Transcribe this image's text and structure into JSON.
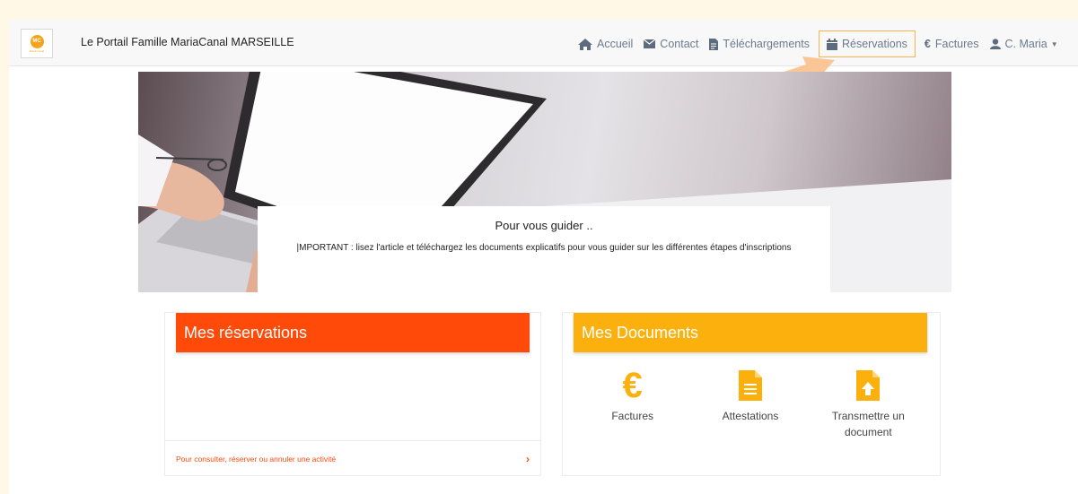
{
  "navbar": {
    "brand": "Le Portail Famille MariaCanal MARSEILLE",
    "logo_text": "MC",
    "items": [
      {
        "label": "Accueil",
        "icon": "home-icon"
      },
      {
        "label": "Contact",
        "icon": "envelope-icon"
      },
      {
        "label": "Téléchargements",
        "icon": "file-icon"
      },
      {
        "label": "Réservations",
        "icon": "calendar-icon",
        "active": true
      },
      {
        "label": "Factures",
        "icon": "euro-icon"
      },
      {
        "label": "C. Maria",
        "icon": "user-icon"
      }
    ]
  },
  "hero": {
    "title": "Pour vous guider ..",
    "text": "|MPORTANT : lisez l'article et téléchargez les documents explicatifs pour vous guider sur les différentes étapes d'inscriptions"
  },
  "reservations": {
    "title": "Mes réservations",
    "link": "Pour consulter, réserver ou annuler une activité"
  },
  "documents": {
    "title": "Mes Documents",
    "items": [
      {
        "label": "Factures",
        "icon": "euro-icon"
      },
      {
        "label": "Attestations",
        "icon": "file-text-icon"
      },
      {
        "label": "Transmettre un document",
        "icon": "file-upload-icon"
      }
    ]
  },
  "colors": {
    "accent_orange": "#ff4a0a",
    "accent_yellow": "#fbb00e",
    "highlight_border": "#f7b34f",
    "nav_text": "#6a7a8c"
  }
}
